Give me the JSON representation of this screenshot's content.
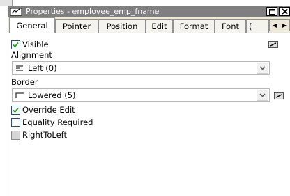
{
  "window": {
    "title": "Properties - employee_emp_fname"
  },
  "tabs": [
    {
      "label": "General",
      "active": true
    },
    {
      "label": "Pointer"
    },
    {
      "label": "Position"
    },
    {
      "label": "Edit"
    },
    {
      "label": "Format"
    },
    {
      "label": "Font"
    },
    {
      "label": "("
    }
  ],
  "general": {
    "visible": {
      "label": "Visible",
      "checked": true
    },
    "alignment": {
      "label": "Alignment",
      "value": "Left (0)",
      "icon": "align-left-icon"
    },
    "border": {
      "label": "Border",
      "value": "Lowered (5)",
      "icon": "border-lowered-icon"
    },
    "override_edit": {
      "label": "Override Edit",
      "checked": true
    },
    "equality_required": {
      "label": "Equality Required",
      "checked": false
    },
    "right_to_left": {
      "label": "RightToLeft",
      "checked": false,
      "disabled": true
    }
  },
  "colors": {
    "titlebar": "#7f7f7f",
    "panel": "#ffffff",
    "checkbox_border": "#1c5180",
    "checkmark": "#21a121"
  }
}
